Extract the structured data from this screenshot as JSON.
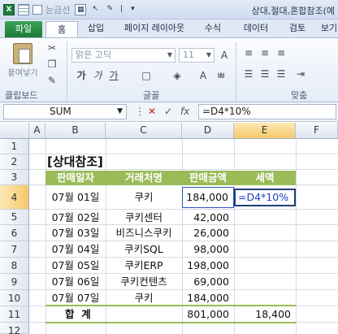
{
  "window": {
    "title": "상대,절대,혼합참조(예",
    "qat_label": "눈금선"
  },
  "ribbon_tabs": [
    "파일",
    "홈",
    "삽입",
    "페이지 레이아웃",
    "수식",
    "데이터",
    "검토",
    "보기"
  ],
  "ribbon": {
    "paste_label": "붙여넣기",
    "clipboard_group": "클립보드",
    "font_group": "글꼴",
    "align_group": "맞춤",
    "font_name": "맑은 고딕",
    "font_size": "11",
    "bold": "가",
    "italic": "가",
    "underline": "가"
  },
  "formula_bar": {
    "name_box": "SUM",
    "cancel": "✕",
    "enter": "✓",
    "fx": "fx",
    "formula": "=D4*10%"
  },
  "columns": [
    "A",
    "B",
    "C",
    "D",
    "E",
    "F"
  ],
  "rows": [
    "1",
    "2",
    "3",
    "4",
    "5",
    "6",
    "7",
    "8",
    "9",
    "10",
    "11",
    "12"
  ],
  "sheet": {
    "title": "[상대참조]",
    "headers": [
      "판매일자",
      "거래처명",
      "판매금액",
      "세액"
    ],
    "data": [
      {
        "date": "07월 01일",
        "client": "쿠키",
        "amount": "184,000",
        "tax": "=D4*10%"
      },
      {
        "date": "07월 02일",
        "client": "쿠키센터",
        "amount": "42,000",
        "tax": ""
      },
      {
        "date": "07월 03일",
        "client": "비즈니스쿠키",
        "amount": "26,000",
        "tax": ""
      },
      {
        "date": "07월 04일",
        "client": "쿠키SQL",
        "amount": "98,000",
        "tax": ""
      },
      {
        "date": "07월 05일",
        "client": "쿠키ERP",
        "amount": "198,000",
        "tax": ""
      },
      {
        "date": "07월 06일",
        "client": "쿠키컨텐츠",
        "amount": "69,000",
        "tax": ""
      },
      {
        "date": "07월 07일",
        "client": "쿠키",
        "amount": "184,000",
        "tax": ""
      }
    ],
    "total_label": "합  계",
    "total_amount": "801,000",
    "total_tax": "18,400"
  },
  "colors": {
    "header_green": "#9bbb59",
    "file_tab": "#1f7a36",
    "active_border": "#1f3f7a"
  }
}
